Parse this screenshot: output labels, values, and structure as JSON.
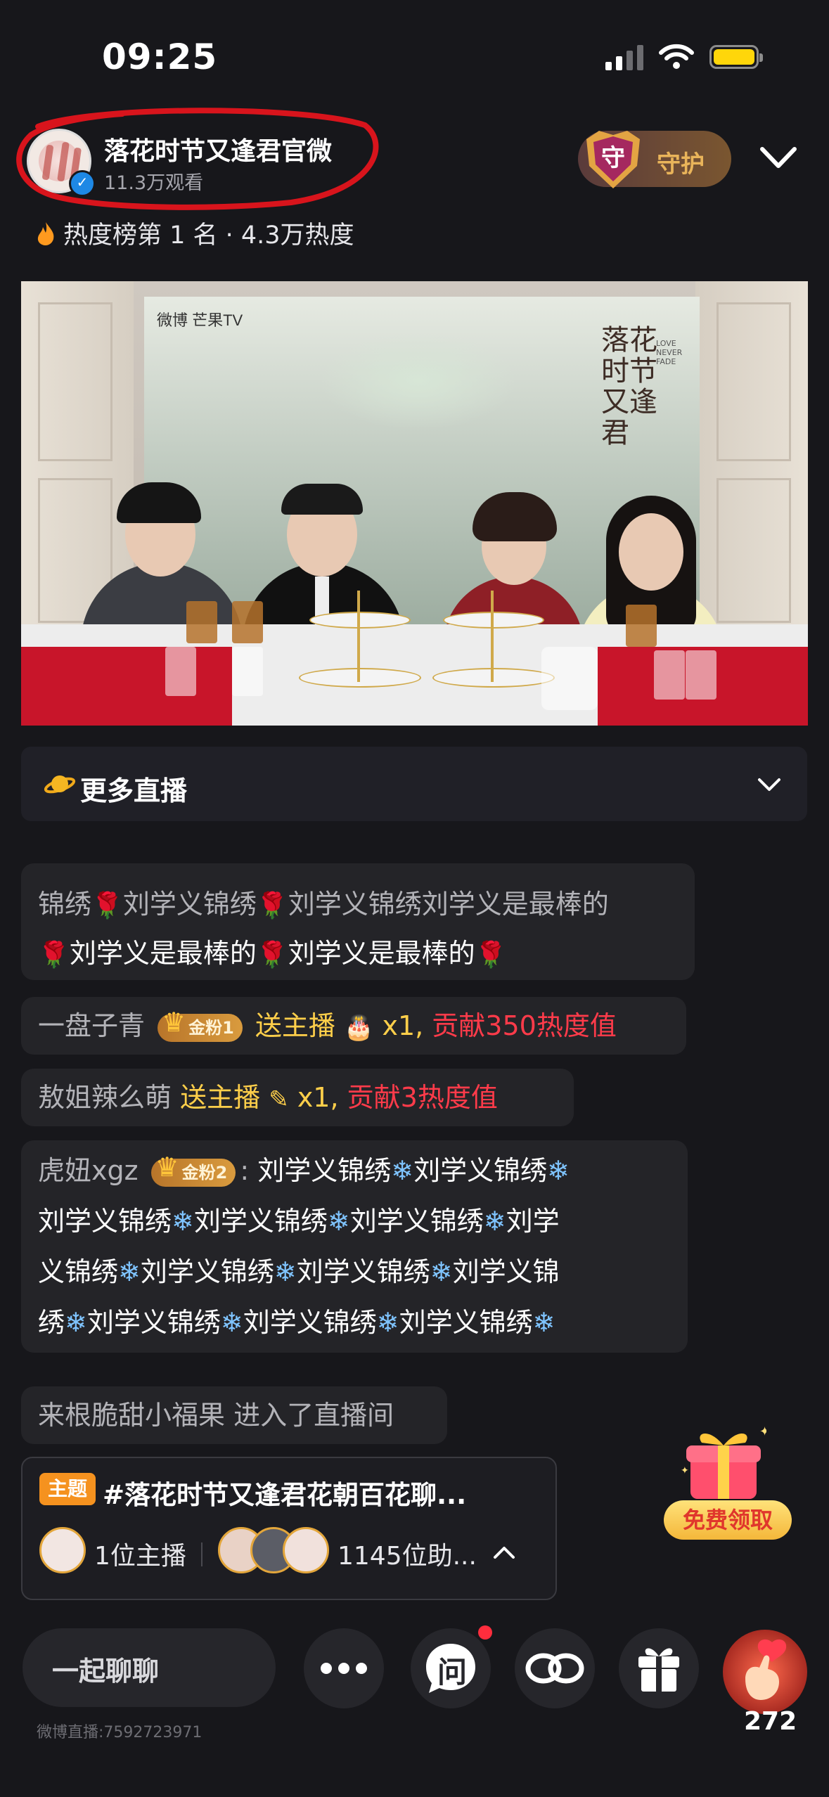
{
  "status_bar": {
    "time": "09:25"
  },
  "header": {
    "host_name": "落花时节又逢君官微",
    "viewers": "11.3万观看",
    "guard_label": "守护",
    "guard_badge_char": "守",
    "heat_rank": "热度榜第 1 名 · 4.3万热度"
  },
  "video": {
    "brand_text": "微博  芒果TV",
    "poster_title": "落花时节又逢君",
    "poster_subtitle": "LOVE NEVER FADE"
  },
  "more_live": {
    "label": "更多直播"
  },
  "chat": {
    "msg1": {
      "line1_parts": [
        "锦绣",
        "刘学义锦绣",
        "刘学义锦绣刘学义是最棒的"
      ],
      "line2_parts": [
        "刘学义是最棒的",
        "刘学义是最棒的"
      ]
    },
    "msg2": {
      "user": "一盘子青",
      "badge": "金粉1",
      "action": "送主播",
      "count": "x1,",
      "contrib": "贡献350热度值"
    },
    "msg3": {
      "user": "敖姐辣么萌",
      "action": "送主播",
      "count": "x1,",
      "contrib": "贡献3热度值"
    },
    "msg4": {
      "user": "虎妞xgz",
      "badge": "金粉2",
      "colon": ":",
      "lines": [
        "刘学义锦绣❄刘学义锦绣❄",
        "刘学义锦绣❄刘学义锦绣❄刘学义锦绣❄刘学",
        "义锦绣❄刘学义锦绣❄刘学义锦绣❄刘学义锦",
        "绣❄刘学义锦绣❄刘学义锦绣❄刘学义锦绣❄"
      ]
    },
    "msg5": {
      "text": "来根脆甜小福果 进入了直播间"
    }
  },
  "topic": {
    "tag": "主题",
    "title": "#落花时节又逢君花朝百花聊...",
    "hosts": "1位主播",
    "helpers": "1145位助..."
  },
  "gift_promo": {
    "label": "免费领取"
  },
  "bottom_bar": {
    "chat_label": "一起聊聊",
    "ask_label": "问",
    "like_count": "272",
    "room_id": "微博直播:7592723971"
  },
  "colors": {
    "gold": "#ffcf4a",
    "contrib_red": "#ff3b4a",
    "accent_orange": "#f5921f",
    "battery": "#ffd60a"
  }
}
